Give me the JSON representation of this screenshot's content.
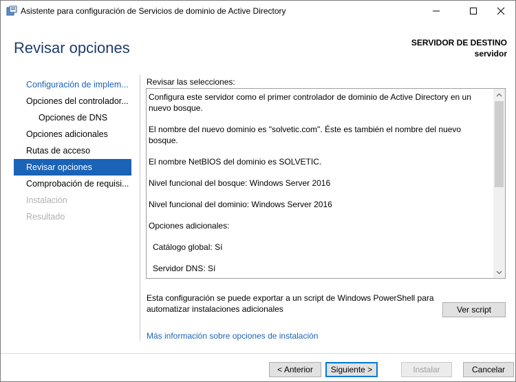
{
  "window": {
    "title": "Asistente para configuración de Servicios de dominio de Active Directory"
  },
  "header": {
    "page_title": "Revisar opciones",
    "dest_label": "SERVIDOR DE DESTINO",
    "dest_name": "servidor"
  },
  "nav": {
    "items": [
      {
        "label": "Configuración de implem..."
      },
      {
        "label": "Opciones del controlador..."
      },
      {
        "label": "Opciones de DNS"
      },
      {
        "label": "Opciones adicionales"
      },
      {
        "label": "Rutas de acceso"
      },
      {
        "label": "Revisar opciones"
      },
      {
        "label": "Comprobación de requisi..."
      },
      {
        "label": "Instalación"
      },
      {
        "label": "Resultado"
      }
    ]
  },
  "main": {
    "section_label": "Revisar las selecciones:",
    "review": {
      "line1": "Configura este servidor como el primer controlador de dominio de Active Directory en un nuevo bosque.",
      "line2": "El nombre del nuevo dominio es \"solvetic.com\". Éste es también el nombre del nuevo bosque.",
      "line3": "El nombre NetBIOS del dominio es SOLVETIC.",
      "line4": "Nivel funcional del bosque: Windows Server 2016",
      "line5": "Nivel funcional del dominio: Windows Server 2016",
      "line6": "Opciones adicionales:",
      "line7": "Catálogo global: Sí",
      "line8": "Servidor DNS: Sí"
    },
    "export_text": "Esta configuración se puede exportar a un script de Windows PowerShell para automatizar instalaciones adicionales",
    "view_script": "Ver script",
    "more_info": "Más información sobre opciones de instalación"
  },
  "footer": {
    "prev": "< Anterior",
    "next": "Siguiente >",
    "install": "Instalar",
    "cancel": "Cancelar"
  }
}
